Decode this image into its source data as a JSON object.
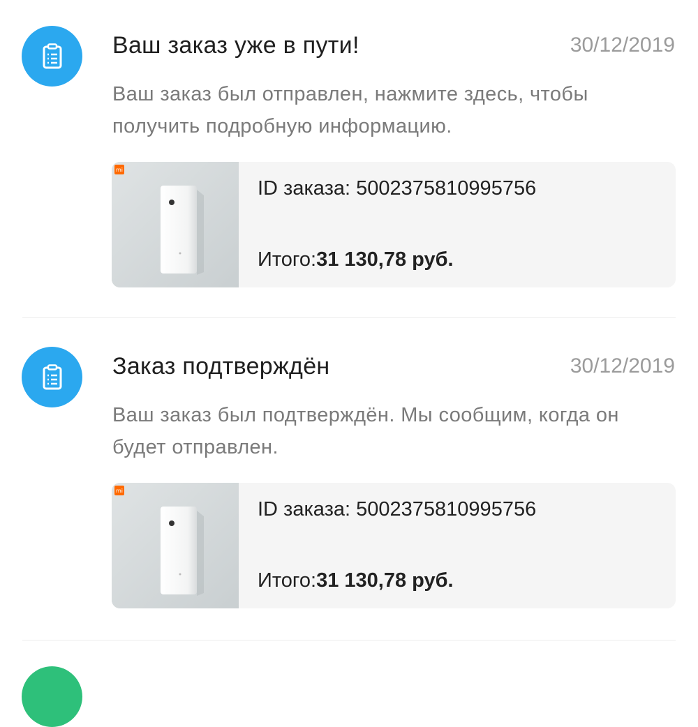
{
  "notifications": [
    {
      "title": "Ваш заказ уже в пути!",
      "date": "30/12/2019",
      "description": "Ваш заказ был отправлен, нажмите здесь, чтобы получить подробную информацию.",
      "order_id": "ID заказа: 5002375810995756",
      "total_label": "Итого:",
      "total_value": "31 130,78 руб.",
      "brand_badge": "mi",
      "icon": "order-list-icon"
    },
    {
      "title": "Заказ подтверждён",
      "date": "30/12/2019",
      "description": "Ваш заказ был подтверждён. Мы сообщим, когда он будет отправлен.",
      "order_id": "ID заказа: 5002375810995756",
      "total_label": "Итого:",
      "total_value": "31 130,78 руб.",
      "brand_badge": "mi",
      "icon": "order-list-icon"
    }
  ],
  "colors": {
    "avatar_blue": "#2ba8ef",
    "avatar_green": "#2ec07a",
    "mi_orange": "#ff6900"
  }
}
